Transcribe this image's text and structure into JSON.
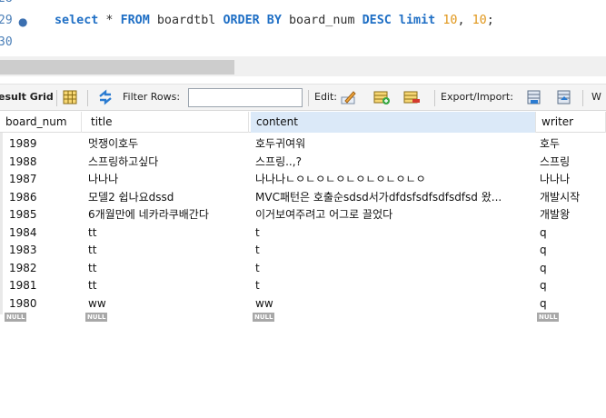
{
  "editor": {
    "line_prev": "28",
    "line_current": "29",
    "line_next": "30",
    "bullet": "●",
    "query": [
      {
        "t": "select",
        "c": "kw"
      },
      {
        "t": " * ",
        "c": "plain"
      },
      {
        "t": "FROM",
        "c": "kw"
      },
      {
        "t": " boardtbl ",
        "c": "plain"
      },
      {
        "t": "ORDER BY",
        "c": "kw"
      },
      {
        "t": " board_num ",
        "c": "plain"
      },
      {
        "t": "DESC limit",
        "c": "kw"
      },
      {
        "t": " ",
        "c": "plain"
      },
      {
        "t": "10",
        "c": "num"
      },
      {
        "t": ", ",
        "c": "plain"
      },
      {
        "t": "10",
        "c": "num"
      },
      {
        "t": ";",
        "c": "plain"
      }
    ]
  },
  "toolbar": {
    "result_grid": "esult Grid",
    "filter_rows": "Filter Rows:",
    "filter_value": "",
    "edit": "Edit:",
    "export_import": "Export/Import:",
    "wrap": "W"
  },
  "grid": {
    "columns": [
      "board_num",
      "title",
      "content",
      "writer"
    ],
    "rows": [
      [
        "1989",
        "멋쟁이호두",
        "호두귀여워",
        "호두"
      ],
      [
        "1988",
        "스프링하고싶다",
        "스프링..,?",
        "스프링"
      ],
      [
        "1987",
        "나나나",
        "나나나ㄴㅇㄴㅇㄴㅇㄴㅇㄴㅇㄴㅇㄴㅇ",
        "나나나"
      ],
      [
        "1986",
        "모델2 쉽나요dssd",
        "MVC패턴은 호출순sdsd서가dfdsfsdfsdfsdfsd 왔...",
        "개발시작"
      ],
      [
        "1985",
        "6개월만에 네카라쿠배간다",
        "이거보여주려고 어그로 끌었다",
        "개발왕"
      ],
      [
        "1984",
        "tt",
        "t",
        "q"
      ],
      [
        "1983",
        "tt",
        "t",
        "q"
      ],
      [
        "1982",
        "tt",
        "t",
        "q"
      ],
      [
        "1981",
        "tt",
        "t",
        "q"
      ],
      [
        "1980",
        "ww",
        "ww",
        "q"
      ]
    ],
    "null_label": "NULL"
  },
  "colors": {
    "keyword": "#1f6fc5",
    "number": "#e0961a",
    "line_number": "#4b7fb8",
    "header_selected": "#dbe9f8"
  }
}
